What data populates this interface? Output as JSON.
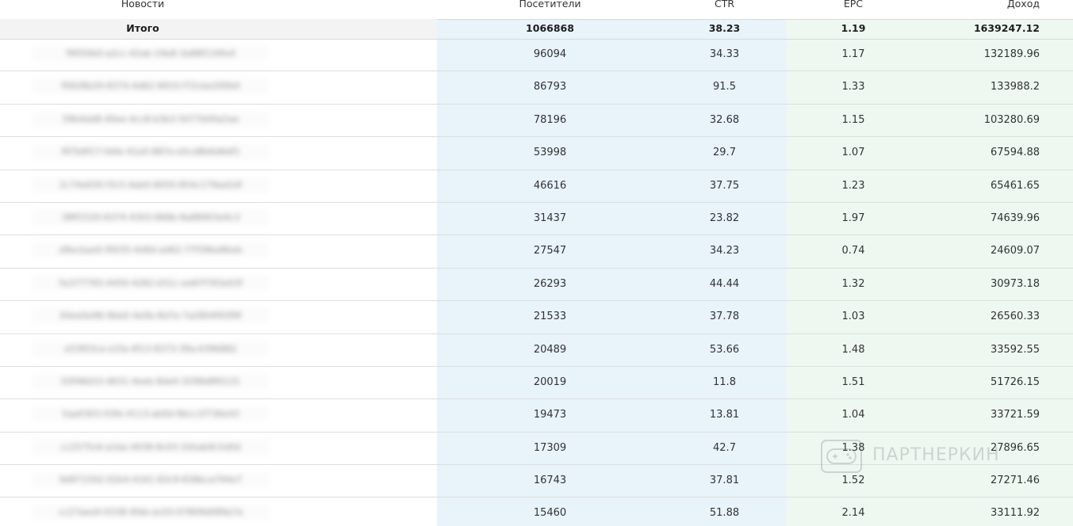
{
  "table": {
    "headers": {
      "name": "Новости",
      "visitors": "Посетители",
      "ctr": "CTR",
      "epc": "EPC",
      "income": "Доход"
    },
    "total": {
      "label": "Итого",
      "visitors": "1066868",
      "ctr": "38.23",
      "epc": "1.19",
      "income": "1639247.12"
    },
    "rows": [
      {
        "name": "f9050b0-a2cc-42ab-19e8-3a88f134fe4",
        "visitors": "96094",
        "ctr": "34.33",
        "epc": "1.17",
        "income": "132189.96"
      },
      {
        "name": "f0928b29-8374-4d62-9910-f72cbe200b0",
        "visitors": "86793",
        "ctr": "91.5",
        "epc": "1.33",
        "income": "133988.2"
      },
      {
        "name": "59b4dd8-40ee-4cc8-b3b3-5077b00a2ae",
        "visitors": "78196",
        "ctr": "32.68",
        "epc": "1.15",
        "income": "103280.69"
      },
      {
        "name": "f97b9f17-fd4e-41e0-887e-e5cd8b6d6df1",
        "visitors": "53998",
        "ctr": "29.7",
        "epc": "1.07",
        "income": "67594.88"
      },
      {
        "name": "2c74a930-f3c5-4ab0-8050-854c179ad2df",
        "visitors": "46616",
        "ctr": "37.75",
        "epc": "1.23",
        "income": "65461.65"
      },
      {
        "name": "38ff1520-6374-4303-868b-8a88903e0c3",
        "visitors": "31437",
        "ctr": "23.82",
        "epc": "1.97",
        "income": "74639.96"
      },
      {
        "name": "d9ecbae0-f0035-4d9d-ad62-77f39be8beb",
        "visitors": "27547",
        "ctr": "34.23",
        "epc": "0.74",
        "income": "24609.07"
      },
      {
        "name": "5e377783-4450-4282-b51c-ee87f783e03f",
        "visitors": "26293",
        "ctr": "44.44",
        "epc": "1.32",
        "income": "30973.18"
      },
      {
        "name": "64ee0e96-9bb0-4e0b-8d7e-7a2804f93f9f",
        "visitors": "21533",
        "ctr": "37.78",
        "epc": "1.03",
        "income": "26560.33"
      },
      {
        "name": "e53f03ce-e1fa-4f13-8373-3fbc4396882",
        "visitors": "20489",
        "ctr": "53.66",
        "epc": "1.48",
        "income": "33592.55"
      },
      {
        "name": "03f46b53-4631-4eeb-8de0-3298d8f0131",
        "visitors": "20019",
        "ctr": "11.8",
        "epc": "1.51",
        "income": "51726.15"
      },
      {
        "name": "5aa0303-03fe-4113-ab0d-8bcc1f736e43",
        "visitors": "19473",
        "ctr": "13.81",
        "epc": "1.04",
        "income": "33721.59"
      },
      {
        "name": "cc2575c6-a1be-4038-8c03-32bab9c5d0d",
        "visitors": "17309",
        "ctr": "42.7",
        "epc": "1.38",
        "income": "27896.65"
      },
      {
        "name": "9d971502-02b4-4161-83c9-838bca794e7",
        "visitors": "16743",
        "ctr": "37.81",
        "epc": "1.52",
        "income": "27271.46"
      },
      {
        "name": "cc27aee0-0338-4fde-ac03-07809d089a7a",
        "visitors": "15460",
        "ctr": "51.88",
        "epc": "2.14",
        "income": "33111.92"
      }
    ]
  },
  "watermark": {
    "text": "ПАРТНЕРКИН",
    "icon": "gamepad-logo-icon"
  }
}
